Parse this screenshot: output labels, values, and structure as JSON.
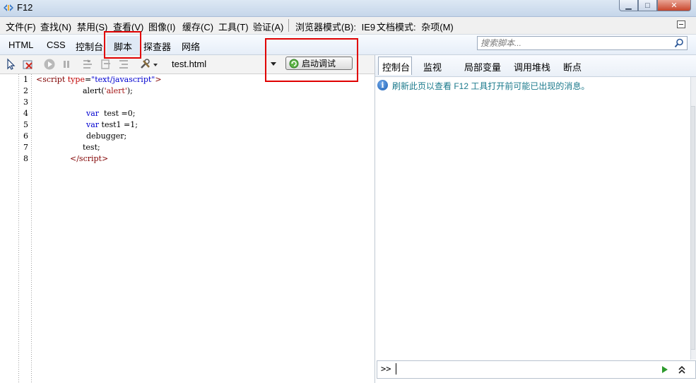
{
  "window": {
    "title": "F12",
    "minimize_glyph": "▁",
    "maximize_glyph": "□",
    "close_glyph": "✕"
  },
  "menu": {
    "items": [
      "文件(F)",
      "查找(N)",
      "禁用(S)",
      "查看(V)",
      "图像(I)",
      "缓存(C)",
      "工具(T)",
      "验证(A)"
    ],
    "browser_mode_label": "浏览器模式(B):",
    "browser_mode_value": "IE9",
    "doc_mode_label": "文档模式:",
    "doc_mode_value": "杂项(M)"
  },
  "tabs": {
    "items": [
      "HTML",
      "CSS",
      "控制台",
      "脚本",
      "探查器",
      "网络"
    ],
    "active": "脚本"
  },
  "search": {
    "placeholder": "搜索脚本..."
  },
  "toolbar": {
    "file_name": "test.html",
    "start_debug_label": "启动调试"
  },
  "right_tabs": {
    "items": [
      "控制台",
      "监视",
      "局部变量",
      "调用堆栈",
      "断点"
    ],
    "active": "控制台"
  },
  "editor": {
    "line_numbers": [
      "1",
      "2",
      "3",
      "4",
      "5",
      "6",
      "7",
      "8"
    ]
  },
  "console": {
    "message": "刷新此页以查看 F12 工具打开前可能已出现的消息。",
    "prompt": ">>"
  },
  "icons": {
    "app": "f12-devtools-icon",
    "select": "select-element-icon",
    "clear_highlight": "clear-browser-cache-icon",
    "continue": "continue-icon",
    "break": "break-all-icon",
    "step_into": "step-into-icon",
    "step_over": "step-over-icon",
    "step_out": "step-out-icon",
    "tools": "tools-icon",
    "refresh": "refresh-green-icon",
    "info": "info-icon",
    "run": "run-script-icon",
    "expand": "multi-line-expand-icon"
  }
}
